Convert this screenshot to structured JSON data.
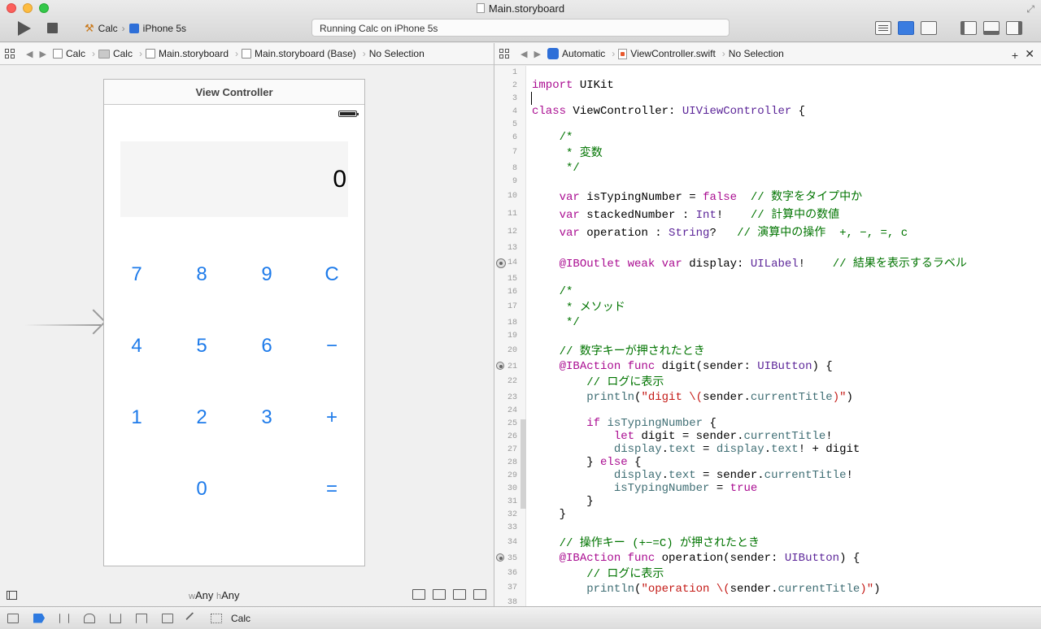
{
  "window": {
    "title": "Main.storyboard"
  },
  "toolbar": {
    "scheme_project": "Calc",
    "scheme_device": "iPhone 5s",
    "activity": "Running Calc on iPhone 5s"
  },
  "left_jumpbar": {
    "crumbs": [
      "Calc",
      "Calc",
      "Main.storyboard",
      "Main.storyboard (Base)",
      "No Selection"
    ]
  },
  "right_jumpbar": {
    "crumbs": [
      "Automatic",
      "ViewController.swift",
      "No Selection"
    ]
  },
  "storyboard": {
    "scene_title": "View Controller",
    "display_value": "0",
    "keys": {
      "k7": "7",
      "k8": "8",
      "k9": "9",
      "kc": "C",
      "k4": "4",
      "k5": "5",
      "k6": "6",
      "kminus": "−",
      "k1": "1",
      "k2": "2",
      "k3": "3",
      "kplus": "+",
      "k0": "0",
      "keq": "="
    },
    "size_class": {
      "w_prefix": "w",
      "w_value": "Any",
      "h_prefix": "h",
      "h_value": "Any"
    }
  },
  "editor": {
    "line_numbers": [
      "1",
      "2",
      "3",
      "4",
      "5",
      "6",
      "7",
      "8",
      "9",
      "10",
      "11",
      "12",
      "13",
      "14",
      "15",
      "16",
      "17",
      "18",
      "19",
      "20",
      "21",
      "22",
      "23",
      "24",
      "25",
      "26",
      "27",
      "28",
      "29",
      "30",
      "31",
      "32",
      "33",
      "34",
      "35",
      "36",
      "37",
      "38"
    ]
  },
  "debugbar": {
    "target_label": "Calc"
  }
}
